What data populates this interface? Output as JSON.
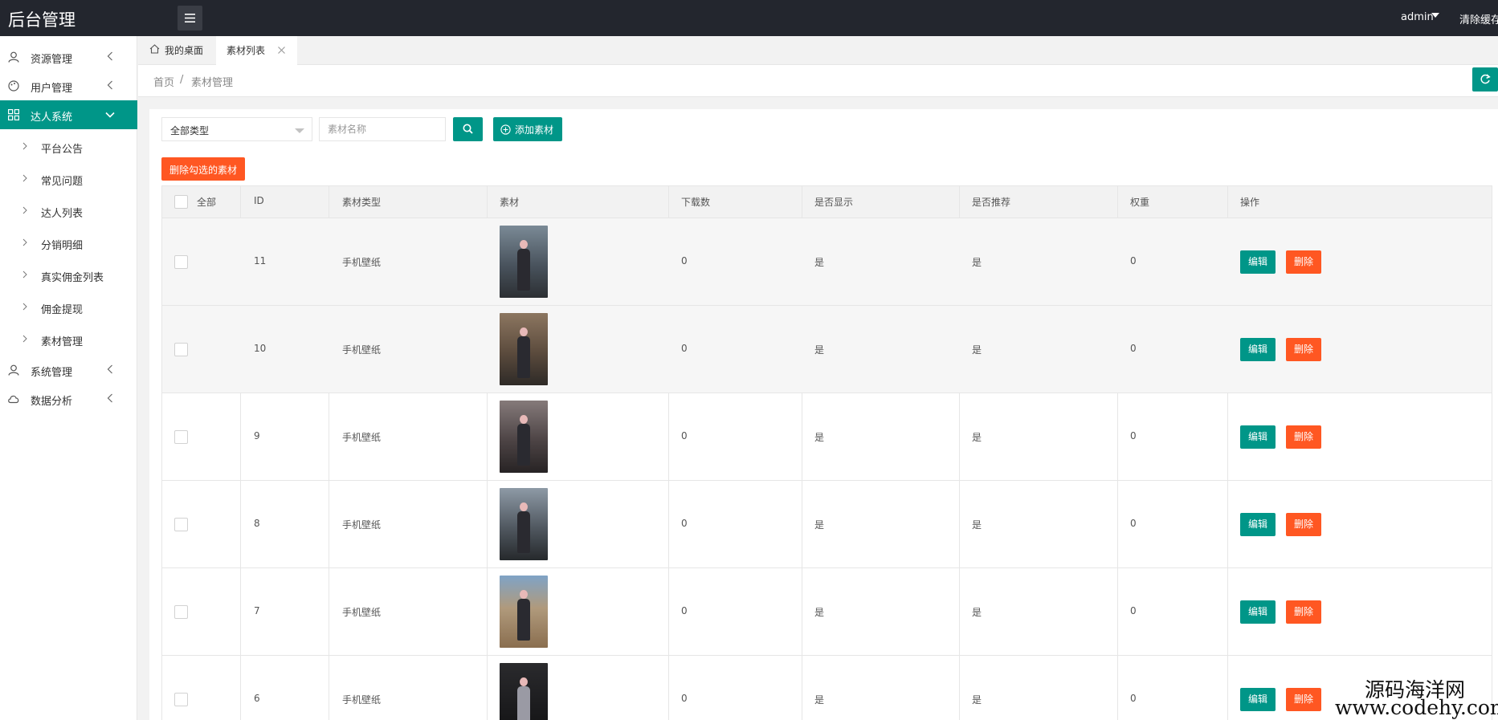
{
  "header": {
    "title": "后台管理",
    "user": "admin",
    "clear_cache": "清除缓存"
  },
  "sidebar": {
    "items": [
      {
        "label": "资源管理",
        "icon": "user-icon"
      },
      {
        "label": "用户管理",
        "icon": "palette-icon"
      },
      {
        "label": "达人系统",
        "icon": "grid-icon",
        "active": true
      },
      {
        "label": "系统管理",
        "icon": "user-icon"
      },
      {
        "label": "数据分析",
        "icon": "cloud-icon"
      }
    ],
    "subitems": [
      "平台公告",
      "常见问题",
      "达人列表",
      "分销明细",
      "真实佣金列表",
      "佣金提现",
      "素材管理"
    ]
  },
  "tabs": {
    "home": "我的桌面",
    "current": "素材列表"
  },
  "breadcrumb": {
    "home": "首页",
    "sep": "/",
    "current": "素材管理"
  },
  "filters": {
    "type_selected": "全部类型",
    "name_placeholder": "素材名称",
    "add_label": "添加素材",
    "delete_selected_label": "删除勾选的素材"
  },
  "table": {
    "headers": {
      "all": "全部",
      "id": "ID",
      "type": "素材类型",
      "material": "素材",
      "downloads": "下载数",
      "show": "是否显示",
      "recommend": "是否推荐",
      "weight": "权重",
      "actions": "操作"
    },
    "edit_label": "编辑",
    "delete_label": "删除",
    "rows": [
      {
        "id": "11",
        "type": "手机壁纸",
        "downloads": "0",
        "show": "是",
        "recommend": "是",
        "weight": "0"
      },
      {
        "id": "10",
        "type": "手机壁纸",
        "downloads": "0",
        "show": "是",
        "recommend": "是",
        "weight": "0"
      },
      {
        "id": "9",
        "type": "手机壁纸",
        "downloads": "0",
        "show": "是",
        "recommend": "是",
        "weight": "0"
      },
      {
        "id": "8",
        "type": "手机壁纸",
        "downloads": "0",
        "show": "是",
        "recommend": "是",
        "weight": "0"
      },
      {
        "id": "7",
        "type": "手机壁纸",
        "downloads": "0",
        "show": "是",
        "recommend": "是",
        "weight": "0"
      },
      {
        "id": "6",
        "type": "手机壁纸",
        "downloads": "0",
        "show": "是",
        "recommend": "是",
        "weight": "0"
      }
    ]
  },
  "watermark": {
    "line1": "源码海洋网",
    "line2": "www.codehy.com"
  },
  "colors": {
    "primary": "#009688",
    "danger": "#ff5722",
    "topbar": "#23262e"
  }
}
